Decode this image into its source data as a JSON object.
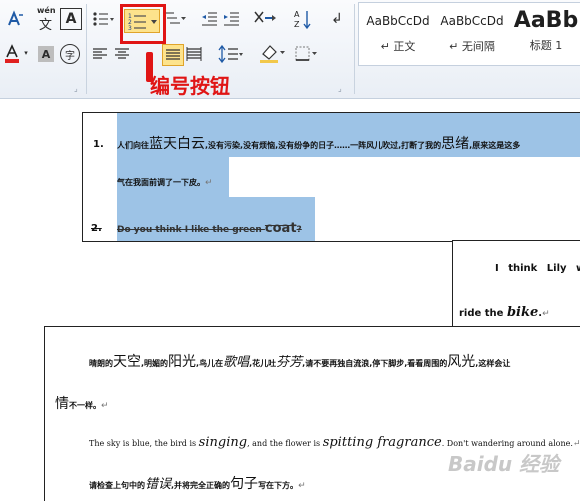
{
  "ribbon": {
    "font_buttons": [
      "wén",
      "A"
    ],
    "multilevel_glyph": "≡",
    "styles": [
      {
        "sample": "AaBbCcDd",
        "label": "↵ 正文"
      },
      {
        "sample": "AaBbCcDd",
        "label": "↵ 无间隔"
      },
      {
        "sample": "AaBb",
        "label": "标题 1"
      }
    ],
    "annotation_label": "编号按钮"
  },
  "doc1": {
    "item1_number": "1.",
    "item1_line1_a": "人们向往",
    "item1_line1_b": "蓝天白云",
    "item1_line1_c": ",没有污染,没有烦恼,没有纷争的日子……一阵风儿吹过,打断了我的",
    "item1_line1_d": "思绪",
    "item1_line1_e": ",原来这是这多",
    "item1_line2": "气在我面前调了一下皮。",
    "item2_number": "2.",
    "item2_a": "Do you think I like the green ",
    "item2_b": "coat",
    "item2_c": "?",
    "para_mark": "↵"
  },
  "doc2": {
    "line1": "I think Lily wa",
    "line2_a": "ride the ",
    "line2_b": "bike",
    "line2_c": "."
  },
  "doc3": {
    "line1": [
      {
        "t": "晴朗的",
        "s": "n"
      },
      {
        "t": "天空",
        "s": "b"
      },
      {
        "t": ",明媚的",
        "s": "n"
      },
      {
        "t": "阳光",
        "s": "b"
      },
      {
        "t": ",鸟儿在",
        "s": "n"
      },
      {
        "t": "歌唱",
        "s": "i"
      },
      {
        "t": ",花儿吐",
        "s": "n"
      },
      {
        "t": "芬芳",
        "s": "i"
      },
      {
        "t": ",请不要再独自流浪,停下脚步,看看周围的",
        "s": "n"
      },
      {
        "t": "风光",
        "s": "b"
      },
      {
        "t": ",这样会让",
        "s": "n"
      }
    ],
    "line2_a": "情",
    "line2_b": "不一样。",
    "line3_a": "The sky is blue, the bird is ",
    "line3_b": "singing",
    "line3_c": ", and the flower is ",
    "line3_d": "spitting fragrance",
    "line3_e": ". Don't wandering around alone.",
    "line4_a": "请检查上句中的",
    "line4_b": "错误",
    "line4_c": ",并将完全正确的",
    "line4_d": "句子",
    "line4_e": "写在下方。"
  },
  "watermark": "Baidu 经验"
}
